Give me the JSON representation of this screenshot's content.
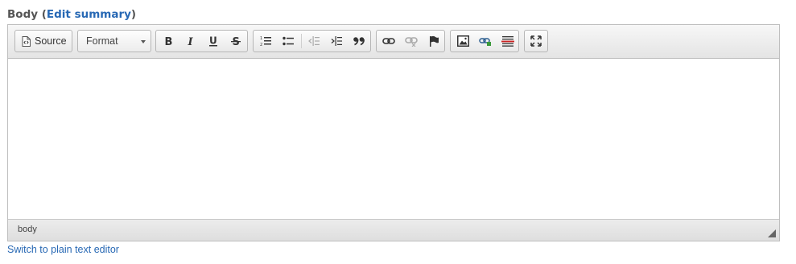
{
  "field": {
    "label": "Body",
    "paren_open": " (",
    "edit_summary_link": "Edit summary",
    "paren_close": ")"
  },
  "toolbar": {
    "source_label": "Source",
    "format_label": "Format",
    "buttons": [
      {
        "name": "bold",
        "icon": "bold-icon"
      },
      {
        "name": "italic",
        "icon": "italic-icon"
      },
      {
        "name": "underline",
        "icon": "underline-icon"
      },
      {
        "name": "strikethrough",
        "icon": "strikethrough-icon"
      },
      {
        "name": "numbered-list",
        "icon": "numbered-list-icon"
      },
      {
        "name": "bulleted-list",
        "icon": "bulleted-list-icon"
      },
      {
        "name": "outdent",
        "icon": "outdent-icon",
        "disabled": true
      },
      {
        "name": "indent",
        "icon": "indent-icon"
      },
      {
        "name": "blockquote",
        "icon": "blockquote-icon"
      },
      {
        "name": "link",
        "icon": "link-icon"
      },
      {
        "name": "unlink",
        "icon": "unlink-icon",
        "disabled": true
      },
      {
        "name": "anchor",
        "icon": "anchor-flag-icon"
      },
      {
        "name": "image",
        "icon": "image-icon"
      },
      {
        "name": "media-link",
        "icon": "media-link-icon"
      },
      {
        "name": "horizontal-rule",
        "icon": "horizontal-rule-icon"
      },
      {
        "name": "maximize",
        "icon": "maximize-icon"
      }
    ]
  },
  "statusbar": {
    "path": "body"
  },
  "switch_editor_link": "Switch to plain text editor",
  "colors": {
    "link": "#2768b4",
    "label": "#555555",
    "toolbar_bg": "#ececec",
    "anchor_red": "#cc2222"
  }
}
